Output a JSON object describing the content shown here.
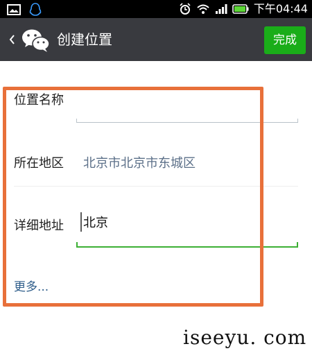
{
  "status_bar": {
    "time": "下午04:44",
    "icons": [
      "image-icon",
      "qq-icon",
      "alarm-icon",
      "wifi-icon",
      "signal-icon",
      "battery-icon"
    ]
  },
  "header": {
    "title": "创建位置",
    "done_label": "完成",
    "icons": [
      "back-chevron-icon",
      "wechat-logo-icon"
    ]
  },
  "form": {
    "name_label": "位置名称",
    "name_value": "",
    "region_label": "所在地区",
    "region_value": "北京市北京市东城区",
    "detail_label": "详细地址",
    "detail_value": "北京",
    "more_label": "更多..."
  },
  "watermark": "iseeyu. com",
  "colors": {
    "status_bar_bg": "#000000",
    "action_bar_bg": "#393a3f",
    "accent_green": "#1aad19",
    "highlight_orange": "#e8703a",
    "link_blue": "#2e5d8a"
  }
}
